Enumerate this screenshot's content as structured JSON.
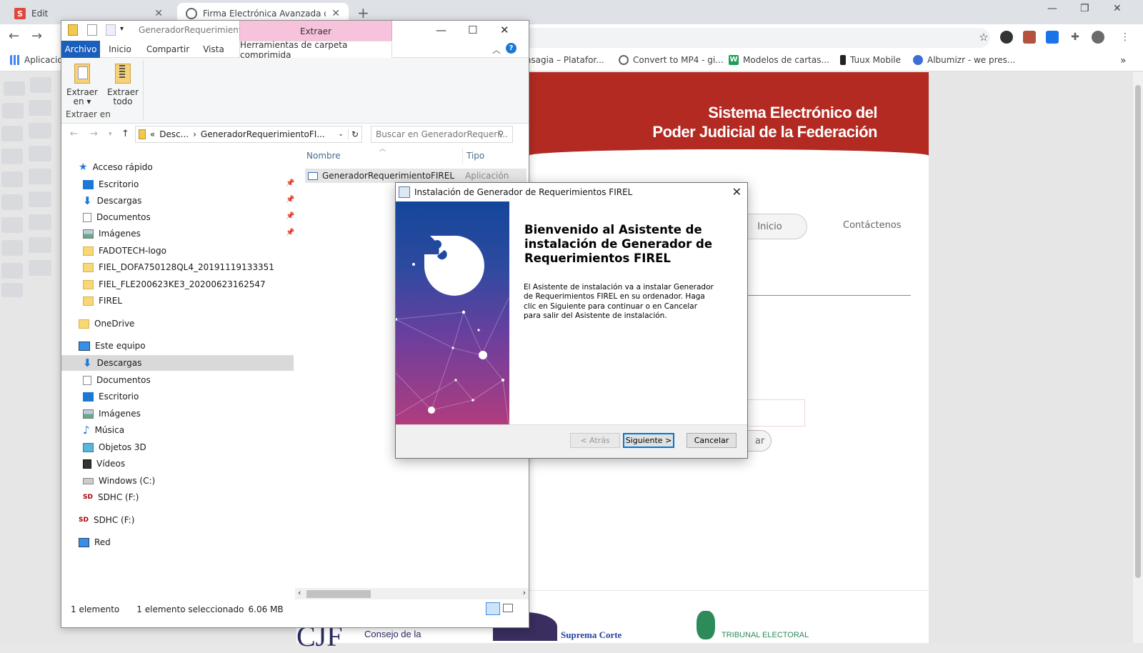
{
  "browser": {
    "tabs": [
      {
        "title": "Edit",
        "favicon": "s-logo-icon"
      },
      {
        "title": "Firma Electrónica Avanzada del P",
        "favicon": "globe-icon"
      }
    ],
    "bookmarks": [
      {
        "label": "Aplicacio",
        "icon": "apps-grid-icon"
      },
      {
        "label": "Mensagia – Platafor...",
        "icon": "m-logo-icon"
      },
      {
        "label": "Convert to MP4 - gi...",
        "icon": "cloud-icon"
      },
      {
        "label": "Modelos de cartas...",
        "icon": "w-logo-icon"
      },
      {
        "label": "Tuux Mobile",
        "icon": "tuux-icon"
      },
      {
        "label": "Albumizr - we pres...",
        "icon": "albumizr-icon"
      }
    ],
    "more_bookmarks": "»"
  },
  "webpage": {
    "header_line1": "Sistema Electrónico del",
    "header_line2": "Poder Judicial de la Federación",
    "nav_inicio": "Inicio",
    "nav_contact": "Contáctenos",
    "button_partial": "ar",
    "footer_cjf": "CJF",
    "footer_consejo": "Consejo de la",
    "footer_scjn": "Suprema Corte",
    "footer_tepjf": "TRIBUNAL ELECTORAL",
    "header_color": "#b22a22"
  },
  "explorer": {
    "title": "GeneradorRequerimient...",
    "context_tab": "Extraer",
    "ribbon_tabs": [
      "Archivo",
      "Inicio",
      "Compartir",
      "Vista",
      "Herramientas de carpeta comprimida"
    ],
    "ribbon_buttons": [
      {
        "label_line1": "Extraer",
        "label_line2": "en ▾"
      },
      {
        "label_line1": "Extraer",
        "label_line2": "todo"
      }
    ],
    "ribbon_group_label": "Extraer en",
    "address": {
      "prefix": "«",
      "part1": "Desc...",
      "sep": "›",
      "part2": "GeneradorRequerimientoFI..."
    },
    "search_placeholder": "Buscar en GeneradorRequeri...",
    "nav": {
      "quick_access": "Acceso rápido",
      "quick_items": [
        "Escritorio",
        "Descargas",
        "Documentos",
        "Imágenes",
        "FADOTECH-logo",
        "FIEL_DOFA750128QL4_20191119133351",
        "FIEL_FLE200623KE3_20200623162547",
        "FIREL"
      ],
      "onedrive": "OneDrive",
      "this_pc": "Este equipo",
      "pc_items": [
        "Descargas",
        "Documentos",
        "Escritorio",
        "Imágenes",
        "Música",
        "Objetos 3D",
        "Vídeos",
        "Windows (C:)",
        "SDHC (F:)"
      ],
      "sdhc": "SDHC (F:)",
      "network": "Red"
    },
    "columns": {
      "name": "Nombre",
      "type": "Tipo"
    },
    "file": {
      "name": "GeneradorRequerimientoFIREL",
      "type": "Aplicación"
    },
    "status": {
      "count": "1 elemento",
      "selected": "1 elemento seleccionado",
      "size": "6.06 MB"
    }
  },
  "installer": {
    "title": "Instalación de Generador de Requerimientos FIREL",
    "heading": "Bienvenido al Asistente de instalación de Generador de Requerimientos FIREL",
    "body": "El Asistente de instalación va a instalar Generador de Requerimientos FIREL en su ordenador. Haga clic en Siguiente para continuar o en Cancelar para salir del Asistente de instalación.",
    "btn_back": "< Atrás",
    "btn_next": "Siguiente >",
    "btn_cancel": "Cancelar"
  }
}
